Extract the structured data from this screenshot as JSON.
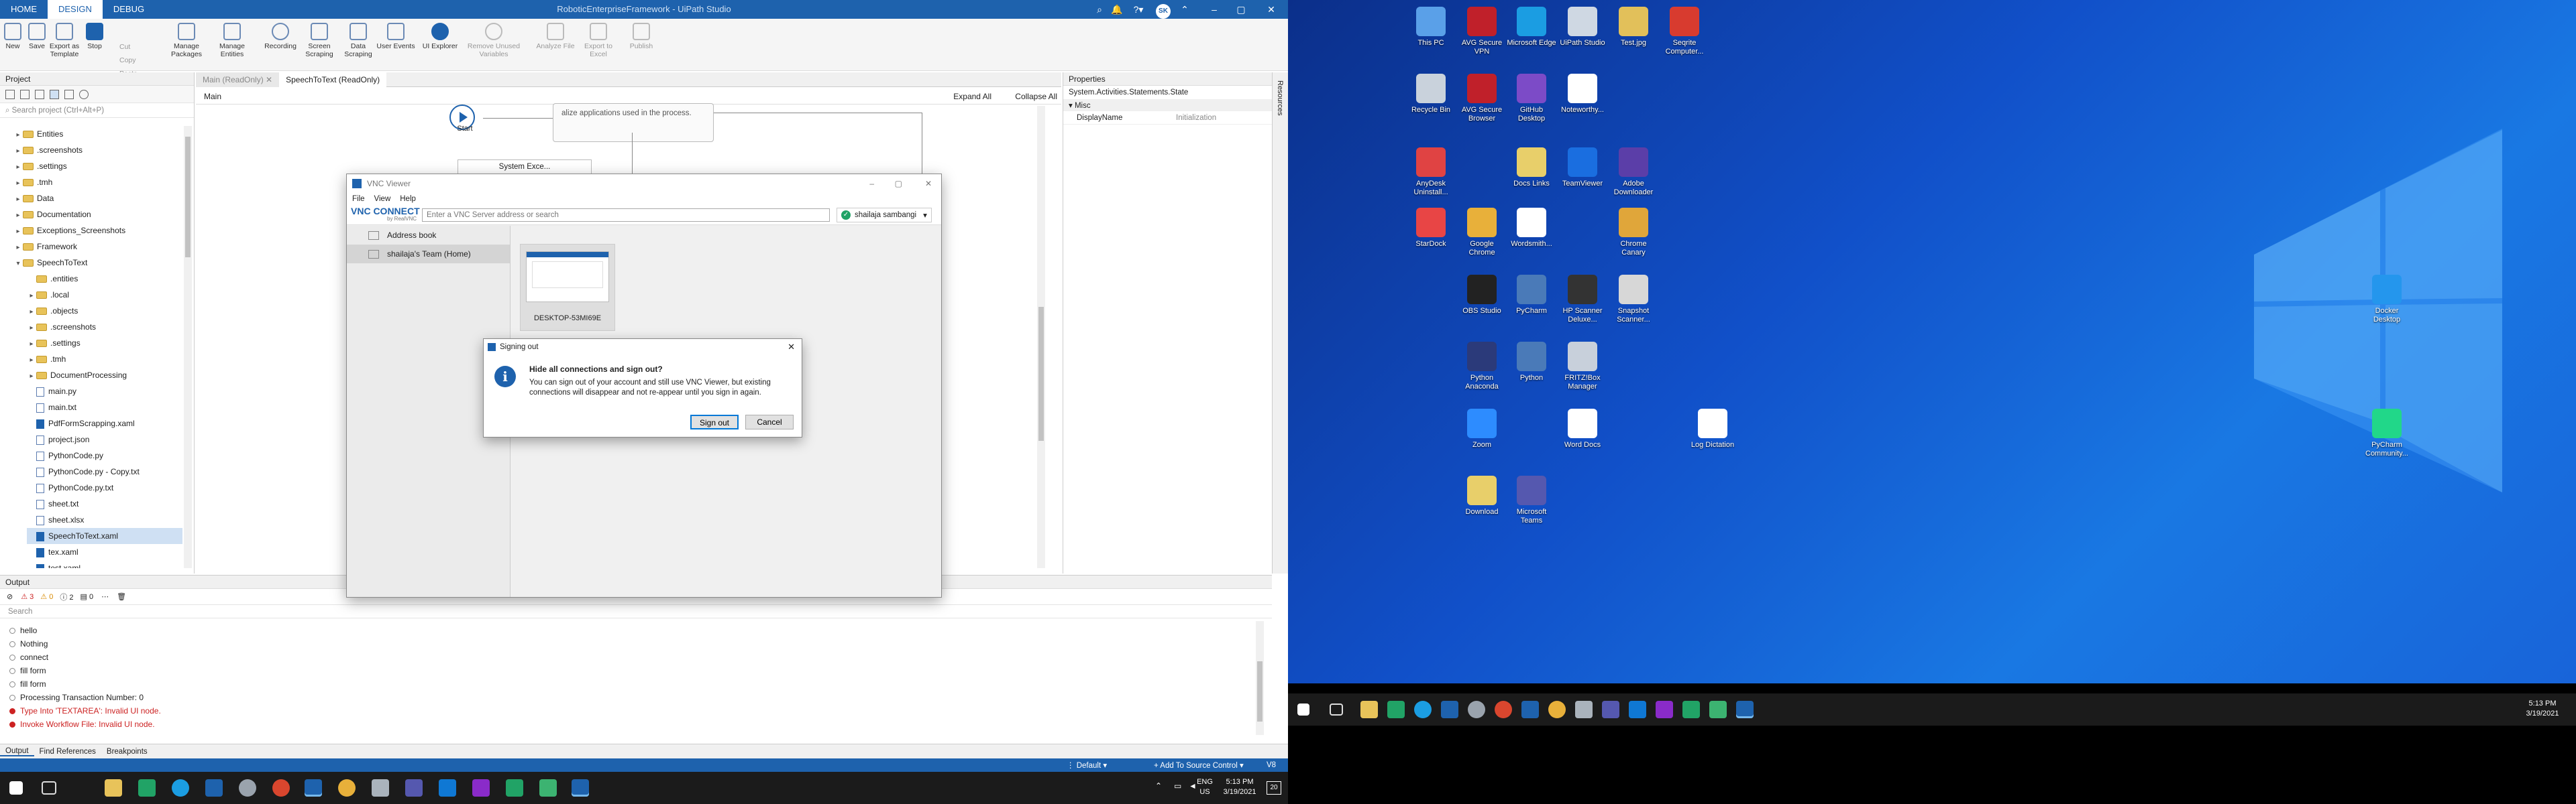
{
  "studio": {
    "title": "RoboticEnterpriseFramework - UiPath Studio",
    "tabs": [
      "HOME",
      "DESIGN",
      "DEBUG"
    ],
    "user_initials": "SK",
    "ribbon": {
      "new": "New",
      "save": "Save",
      "export_template": "Export as Template",
      "stop": "Stop",
      "cut": "Cut",
      "copy": "Copy",
      "paste": "Paste",
      "manage_packages": "Manage Packages",
      "manage_entities": "Manage Entities",
      "recording": "Recording",
      "screen_scraping": "Screen Scraping",
      "data_scraping": "Data Scraping",
      "user_events": "User Events",
      "ui_explorer": "UI Explorer",
      "remove_unused": "Remove Unused Variables",
      "analyze_file": "Analyze File",
      "export_excel": "Export to Excel",
      "publish": "Publish"
    },
    "project": {
      "header": "Project",
      "search_placeholder": "Search project (Ctrl+Alt+P)",
      "items": [
        {
          "label": "Entities",
          "type": "folder",
          "indent": 1,
          "caret": "▸"
        },
        {
          "label": ".screenshots",
          "type": "folder",
          "indent": 1,
          "caret": "▸"
        },
        {
          "label": ".settings",
          "type": "folder",
          "indent": 1,
          "caret": "▸"
        },
        {
          "label": ".tmh",
          "type": "folder",
          "indent": 1,
          "caret": "▸"
        },
        {
          "label": "Data",
          "type": "folder",
          "indent": 1,
          "caret": "▸"
        },
        {
          "label": "Documentation",
          "type": "folder",
          "indent": 1,
          "caret": "▸"
        },
        {
          "label": "Exceptions_Screenshots",
          "type": "folder",
          "indent": 1,
          "caret": "▸"
        },
        {
          "label": "Framework",
          "type": "folder",
          "indent": 1,
          "caret": "▸"
        },
        {
          "label": "SpeechToText",
          "type": "folder",
          "indent": 1,
          "caret": "▾"
        },
        {
          "label": ".entities",
          "type": "folder",
          "indent": 2,
          "caret": ""
        },
        {
          "label": ".local",
          "type": "folder",
          "indent": 2,
          "caret": "▸"
        },
        {
          "label": ".objects",
          "type": "folder",
          "indent": 2,
          "caret": "▸"
        },
        {
          "label": ".screenshots",
          "type": "folder",
          "indent": 2,
          "caret": "▸"
        },
        {
          "label": ".settings",
          "type": "folder",
          "indent": 2,
          "caret": "▸"
        },
        {
          "label": ".tmh",
          "type": "folder",
          "indent": 2,
          "caret": "▸"
        },
        {
          "label": "DocumentProcessing",
          "type": "folder",
          "indent": 2,
          "caret": "▸"
        },
        {
          "label": "main.py",
          "type": "file",
          "indent": 2,
          "caret": ""
        },
        {
          "label": "main.txt",
          "type": "file",
          "indent": 2,
          "caret": ""
        },
        {
          "label": "PdfFormScrapping.xaml",
          "type": "xaml",
          "indent": 2,
          "caret": ""
        },
        {
          "label": "project.json",
          "type": "file",
          "indent": 2,
          "caret": ""
        },
        {
          "label": "PythonCode.py",
          "type": "file",
          "indent": 2,
          "caret": ""
        },
        {
          "label": "PythonCode.py - Copy.txt",
          "type": "file",
          "indent": 2,
          "caret": ""
        },
        {
          "label": "PythonCode.py.txt",
          "type": "file",
          "indent": 2,
          "caret": ""
        },
        {
          "label": "sheet.txt",
          "type": "file",
          "indent": 2,
          "caret": ""
        },
        {
          "label": "sheet.xlsx",
          "type": "file",
          "indent": 2,
          "caret": ""
        },
        {
          "label": "SpeechToText.xaml",
          "type": "xaml",
          "indent": 2,
          "caret": "",
          "selected": true
        },
        {
          "label": "tex.xaml",
          "type": "xaml",
          "indent": 2,
          "caret": ""
        },
        {
          "label": "test.xaml",
          "type": "xaml",
          "indent": 2,
          "caret": ""
        }
      ]
    },
    "doc_tabs": [
      "Main (ReadOnly)",
      "SpeechToText (ReadOnly)"
    ],
    "designer": {
      "breadcrumb": "Main",
      "expand_all": "Expand All",
      "collapse_all": "Collapse All",
      "start": "Start",
      "note": "alize applications used in the process.",
      "state": "System Exce..."
    },
    "properties": {
      "header": "Properties",
      "type": "System.Activities.Statements.State",
      "category": "Misc",
      "rows": [
        {
          "name": "DisplayName",
          "value": "Initialization"
        }
      ]
    },
    "resources_tab": "Resources",
    "output": {
      "header": "Output",
      "filters": [
        "3",
        "0",
        "2",
        "0"
      ],
      "search_placeholder": "Search",
      "lines": [
        {
          "text": "hello",
          "err": false
        },
        {
          "text": "Nothing",
          "err": false
        },
        {
          "text": "connect",
          "err": false
        },
        {
          "text": "fill form",
          "err": false
        },
        {
          "text": "fill form",
          "err": false
        },
        {
          "text": "Processing Transaction Number: 0",
          "err": false
        },
        {
          "text": "Type Into 'TEXTAREA': Invalid UI node.",
          "err": true
        },
        {
          "text": "Invoke Workflow File: Invalid UI node.",
          "err": true
        }
      ],
      "tabs": [
        "Output",
        "Find References",
        "Breakpoints"
      ]
    },
    "statusbar": {
      "default": "Default",
      "source_control": "Add To Source Control",
      "version": "V8"
    }
  },
  "vnc": {
    "title": "VNC Viewer",
    "menu": [
      "File",
      "View",
      "Help"
    ],
    "logo": "VNC CONNECT",
    "logo_sub": "by RealVNC",
    "address_placeholder": "Enter a VNC Server address or search",
    "user": "shailaja sambangi",
    "sidebar": [
      "Address book",
      "shailaja's Team (Home)"
    ],
    "computer": "DESKTOP-53MI69E"
  },
  "dialog": {
    "title": "Signing out",
    "heading": "Hide all connections and sign out?",
    "body": "You can sign out of your account and still use VNC Viewer, but existing connections will disappear and not re-appear until you sign in again.",
    "signout": "Sign out",
    "cancel": "Cancel"
  },
  "taskbar1": {
    "lang": "ENG",
    "region": "US",
    "time": "5:13 PM",
    "date": "3/19/2021",
    "notif": "20"
  },
  "taskbar2": {
    "time": "5:13 PM",
    "date": "3/19/2021"
  },
  "desktop_icons": [
    {
      "label": "This PC",
      "color": "#5aa0e8"
    },
    {
      "label": "AVG Secure VPN",
      "color": "#c0202a"
    },
    {
      "label": "Microsoft Edge",
      "color": "#1b9de2"
    },
    {
      "label": "UiPath Studio",
      "color": "#cfd8e3"
    },
    {
      "label": "Test.jpg",
      "color": "#e2c05a"
    },
    {
      "label": "Seqrite Computer...",
      "color": "#d83b2f"
    },
    {
      "label": "Recycle Bin",
      "color": "#c9d2dc"
    },
    {
      "label": "AVG Secure Browser",
      "color": "#c0202a"
    },
    {
      "label": "GitHub Desktop",
      "color": "#7c4bc7"
    },
    {
      "label": "Noteworthy...",
      "color": "#ffffff"
    },
    {
      "label": "AnyDesk Uninstall...",
      "color": "#e04343"
    },
    {
      "label": "Docs Links",
      "color": "#e8cf6a"
    },
    {
      "label": "TeamViewer",
      "color": "#1a6ee0"
    },
    {
      "label": "Adobe Downloader",
      "color": "#5b3ea8"
    },
    {
      "label": "StarDock",
      "color": "#e84545"
    },
    {
      "label": "Google Chrome",
      "color": "#e8b03a"
    },
    {
      "label": "Wordsmith...",
      "color": "#ffffff"
    },
    {
      "label": "Chrome Canary",
      "color": "#e0a63a"
    },
    {
      "label": "OBS Studio",
      "color": "#222222"
    },
    {
      "label": "PyCharm",
      "color": "#4a7ab8"
    },
    {
      "label": "HP Scanner Deluxe...",
      "color": "#333333"
    },
    {
      "label": "Snapshot Scanner...",
      "color": "#d7d7d7"
    },
    {
      "label": "Python Anaconda",
      "color": "#2b3a7a"
    },
    {
      "label": "Python",
      "color": "#4a7ab8"
    },
    {
      "label": "FRITZ!Box Manager",
      "color": "#c8d0db"
    },
    {
      "label": "Zoom",
      "color": "#2d8cff"
    },
    {
      "label": "Word Docs",
      "color": "#ffffff"
    },
    {
      "label": "Log Dictation",
      "color": "#ffffff"
    },
    {
      "label": "Download",
      "color": "#e8cf6a"
    },
    {
      "label": "Microsoft Teams",
      "color": "#5558af"
    },
    {
      "label": "Docker Desktop",
      "color": "#2496ed"
    },
    {
      "label": "PyCharm Community...",
      "color": "#21d789"
    }
  ]
}
